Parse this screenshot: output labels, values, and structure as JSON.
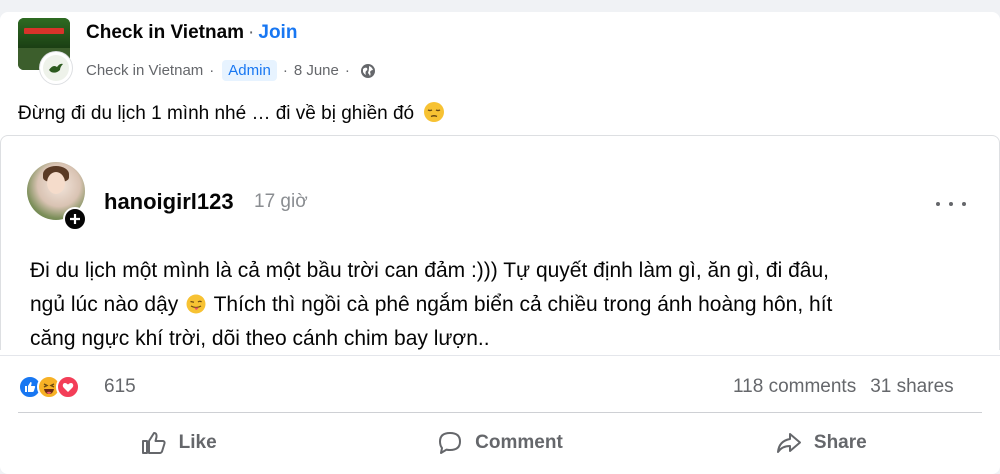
{
  "post": {
    "group_name": "Check in Vietnam",
    "join_label": "Join",
    "author": "Check in Vietnam",
    "author_badge": "Admin",
    "date": "8 June",
    "text": "Đừng đi du lịch 1 mình nhé … đi về bị ghiền đó",
    "text_emoji": "pensive-face"
  },
  "shared_post": {
    "username": "hanoigirl123",
    "time": "17 giờ",
    "lines": [
      "Đi du lịch một mình là cả một bầu trời can đảm :))) Tự quyết định làm gì, ăn gì, đi đâu,",
      "ngủ lúc nào dậy",
      "Thích thì ngồi cà phê ngắm biển cả chiều trong ánh hoàng hôn, hít",
      "căng ngực khí trời, dõi theo cánh chim bay lượn.."
    ],
    "inline_emoji": "winking-tongue-face"
  },
  "stats": {
    "reactions": [
      "like",
      "haha",
      "love"
    ],
    "reaction_count": "615",
    "comments": "118 comments",
    "shares": "31 shares"
  },
  "actions": {
    "like": "Like",
    "comment": "Comment",
    "share": "Share"
  },
  "colors": {
    "accent": "#1877f2",
    "secondary_text": "#65676b",
    "like": "#1877f2",
    "love": "#f33e58",
    "haha": "#f7b125"
  }
}
